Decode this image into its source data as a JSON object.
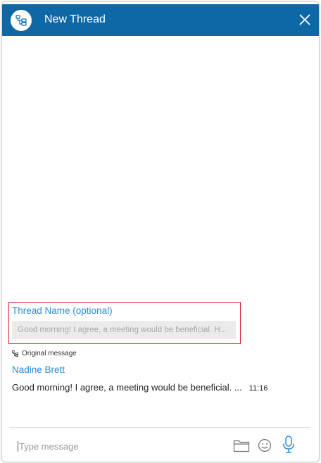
{
  "header": {
    "title": "New Thread",
    "accent_color": "#0e68a5",
    "badge_icon": "thread-icon",
    "close_icon": "close-icon"
  },
  "thread_form": {
    "label": "Thread Name (optional)",
    "placeholder": "Good morning! I agree, a meeting would be beneficial. H..."
  },
  "original": {
    "caption": "Original message",
    "sender": "Nadine Brett",
    "message": "Good morning! I agree, a meeting would be beneficial. ...",
    "time": "11:16"
  },
  "composer": {
    "placeholder": "Type message",
    "icons": [
      "folder-icon",
      "emoji-icon",
      "microphone-icon"
    ]
  }
}
